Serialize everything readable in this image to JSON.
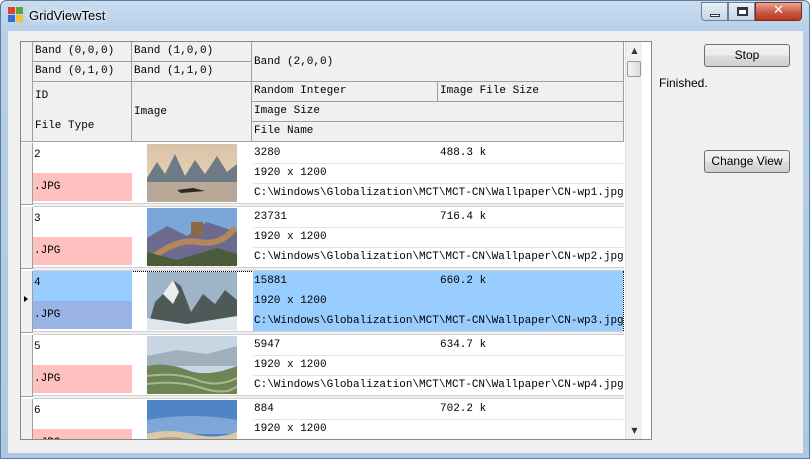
{
  "window": {
    "title": "GridViewTest"
  },
  "grid": {
    "headers": {
      "band_000": "Band (0,0,0)",
      "band_100": "Band (1,0,0)",
      "band_010": "Band (0,1,0)",
      "band_110": "Band (1,1,0)",
      "band_200": "Band (2,0,0)",
      "id": "ID",
      "file_type": "File Type",
      "image": "Image",
      "random_integer": "Random Integer",
      "image_file_size": "Image File Size",
      "image_size": "Image Size",
      "file_name": "File Name"
    },
    "rows": [
      {
        "id": "2",
        "file_type": ".JPG",
        "random_integer": "3280",
        "file_size": "488.3 k",
        "image_size": "1920 x 1200",
        "file_name": "C:\\Windows\\Globalization\\MCT\\MCT-CN\\Wallpaper\\CN-wp1.jpg",
        "selected": false
      },
      {
        "id": "3",
        "file_type": ".JPG",
        "random_integer": "23731",
        "file_size": "716.4 k",
        "image_size": "1920 x 1200",
        "file_name": "C:\\Windows\\Globalization\\MCT\\MCT-CN\\Wallpaper\\CN-wp2.jpg",
        "selected": false
      },
      {
        "id": "4",
        "file_type": ".JPG",
        "random_integer": "15881",
        "file_size": "660.2 k",
        "image_size": "1920 x 1200",
        "file_name": "C:\\Windows\\Globalization\\MCT\\MCT-CN\\Wallpaper\\CN-wp3.jpg",
        "selected": true
      },
      {
        "id": "5",
        "file_type": ".JPG",
        "random_integer": "5947",
        "file_size": "634.7 k",
        "image_size": "1920 x 1200",
        "file_name": "C:\\Windows\\Globalization\\MCT\\MCT-CN\\Wallpaper\\CN-wp4.jpg",
        "selected": false
      },
      {
        "id": "6",
        "file_type": ".JPG",
        "random_integer": "884",
        "file_size": "702.2 k",
        "image_size": "1920 x 1200",
        "file_name": "",
        "selected": false
      }
    ]
  },
  "controls": {
    "stop_label": "Stop",
    "status_text": "Finished.",
    "change_view_label": "Change View"
  },
  "colors": {
    "file_type_bg": "#ffc0c0",
    "selected_bg": "#99ccff",
    "selected_type_bg": "#99b3e6"
  }
}
